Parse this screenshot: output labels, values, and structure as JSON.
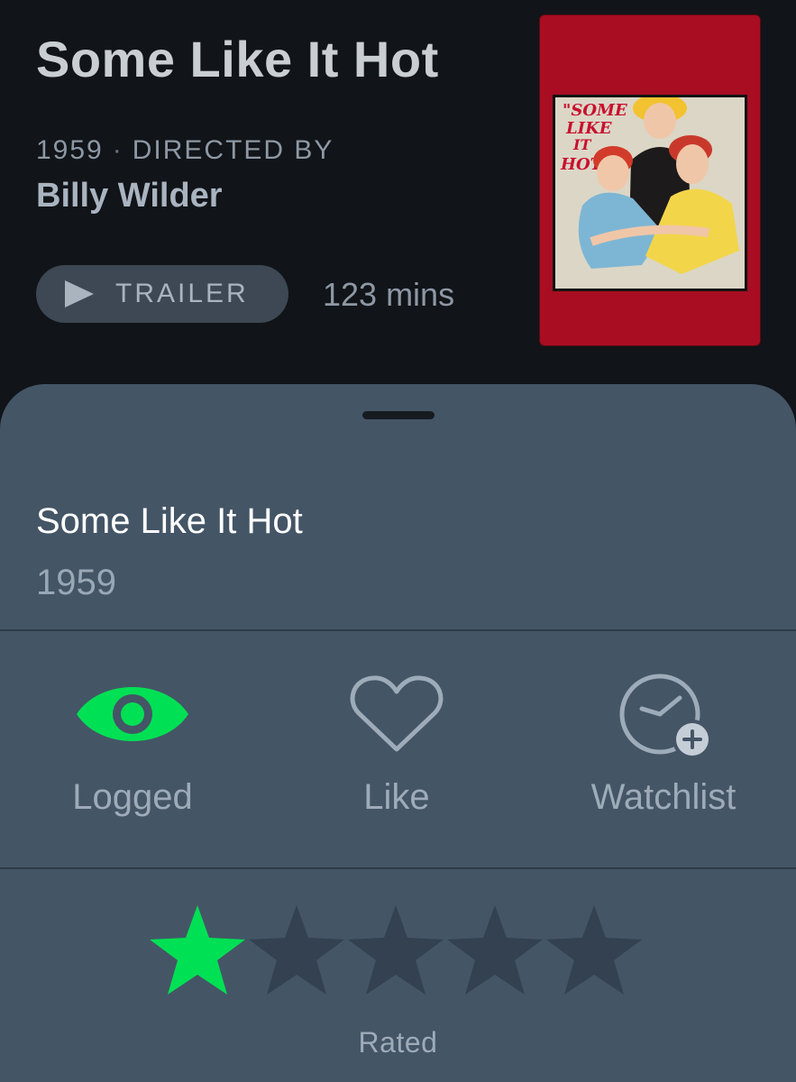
{
  "film": {
    "title": "Some Like It Hot",
    "year": "1959",
    "meta_separator": "·",
    "directed_by_label": "DIRECTED BY",
    "director": "Billy Wilder",
    "trailer_label": "TRAILER",
    "runtime": "123 mins",
    "poster": {
      "title_text": "SOME LIKE IT HOT",
      "background_color": "#a80d22",
      "icon": "movie-poster"
    }
  },
  "sheet": {
    "title": "Some Like It Hot",
    "year": "1959",
    "actions": [
      {
        "label": "Logged",
        "icon": "eye-icon",
        "active": true,
        "color": "#00e054"
      },
      {
        "label": "Like",
        "icon": "heart-outline-icon",
        "active": false,
        "color": "#9eabb8"
      },
      {
        "label": "Watchlist",
        "icon": "clock-plus-icon",
        "active": false,
        "color": "#9eabb8"
      }
    ],
    "rating": {
      "value": 1,
      "max": 5,
      "filled_color": "#00e054",
      "empty_color": "#334150",
      "label": "Rated"
    }
  },
  "colors": {
    "header_background": "#111418",
    "sheet_background": "#445566",
    "accent_green": "#00e054"
  }
}
